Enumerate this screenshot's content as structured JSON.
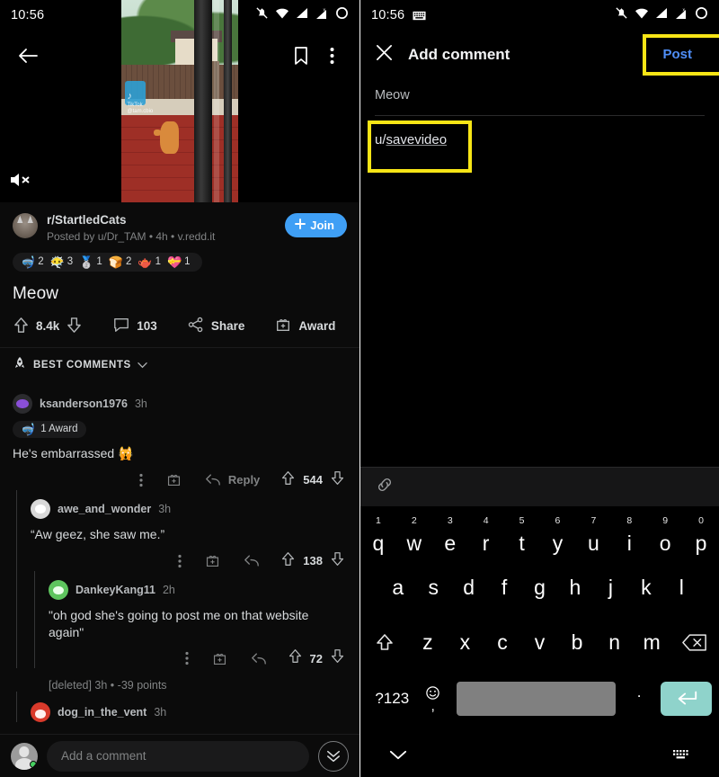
{
  "left": {
    "status": {
      "time": "10:56",
      "icons": [
        "bell-muted-icon",
        "wifi-icon",
        "signal-icon",
        "signal-x-icon",
        "battery-circle-icon"
      ]
    },
    "topbar": {
      "back": "back-arrow-icon",
      "save": "bookmark-icon",
      "more": "overflow-menu-icon"
    },
    "video": {
      "muted": true,
      "mute_label": "mute-icon",
      "watermark": "TikTok",
      "watermark_sub": "@tam.cbio"
    },
    "post": {
      "subreddit": "r/StartledCats",
      "byline": "Posted by u/Dr_TAM • 4h • v.redd.it",
      "join_label": "Join",
      "title": "Meow",
      "awards": [
        {
          "glyph": "🤿",
          "count": "2"
        },
        {
          "glyph": "😶‍🌫️",
          "count": "3"
        },
        {
          "glyph": "🥈",
          "count": "1"
        },
        {
          "glyph": "🍞",
          "count": "2"
        },
        {
          "glyph": "🫖",
          "count": "1"
        },
        {
          "glyph": "💝",
          "count": "1"
        }
      ],
      "upvotes": "8.4k",
      "comments_count": "103",
      "share_label": "Share",
      "award_label": "Award"
    },
    "sort": {
      "label": "BEST COMMENTS"
    },
    "comments": [
      {
        "user": "ksanderson1976",
        "time": "3h",
        "avatar": "purple",
        "award_chip": "1 Award",
        "text": "He's embarrassed 🙀",
        "reply_label": "Reply",
        "score": "544",
        "depth": 0
      },
      {
        "user": "awe_and_wonder",
        "time": "3h",
        "avatar": "white",
        "text": "“Aw geez, she saw me.”",
        "score": "138",
        "depth": 1
      },
      {
        "user": "DankeyKang11",
        "time": "2h",
        "avatar": "green",
        "text": "\"oh god she's going to post me on that website again\"",
        "score": "72",
        "depth": 2
      }
    ],
    "deleted_comment": "[deleted] 3h • -39 points",
    "last_comment": {
      "user": "dog_in_the_vent",
      "time": "3h",
      "avatar": "red"
    },
    "bottombar": {
      "placeholder": "Add a comment",
      "jump": "jump-to-next-icon"
    }
  },
  "right": {
    "status": {
      "time": "10:56",
      "keyboard_icon": "keyboard-icon",
      "icons": [
        "bell-muted-icon",
        "wifi-icon",
        "signal-icon",
        "signal-x-icon",
        "battery-circle-icon"
      ]
    },
    "topbar": {
      "close": "close-icon",
      "title": "Add comment",
      "post_label": "Post"
    },
    "parent_post_title": "Meow",
    "editor": {
      "prefix": "u/",
      "mention": "savevideo",
      "full_value": "u/savevideo"
    },
    "format_bar": {
      "link": "link-icon"
    },
    "highlights": [
      {
        "name": "post-button-highlight",
        "color": "#f7e516"
      },
      {
        "name": "comment-editor-highlight",
        "color": "#f7e516"
      }
    ],
    "keyboard": {
      "row1": [
        {
          "letter": "q",
          "num": "1"
        },
        {
          "letter": "w",
          "num": "2"
        },
        {
          "letter": "e",
          "num": "3"
        },
        {
          "letter": "r",
          "num": "4"
        },
        {
          "letter": "t",
          "num": "5"
        },
        {
          "letter": "y",
          "num": "6"
        },
        {
          "letter": "u",
          "num": "7"
        },
        {
          "letter": "i",
          "num": "8"
        },
        {
          "letter": "o",
          "num": "9"
        },
        {
          "letter": "p",
          "num": "0"
        }
      ],
      "row2": [
        "a",
        "s",
        "d",
        "f",
        "g",
        "h",
        "j",
        "k",
        "l"
      ],
      "row3": [
        "z",
        "x",
        "c",
        "v",
        "b",
        "n",
        "m"
      ],
      "shift": "shift-icon",
      "backspace": "backspace-icon",
      "sym_label": "?123",
      "emoji": "emoji-icon",
      "comma": ",",
      "space": "",
      "period": ".",
      "enter": "enter-icon"
    },
    "navbar": {
      "back": "chevron-down-icon",
      "keyboard": "keyboard-icon"
    }
  }
}
